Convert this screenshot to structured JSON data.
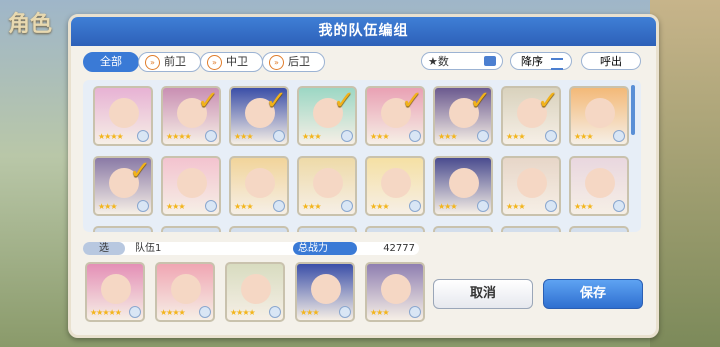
{
  "background": {
    "title": "角色"
  },
  "dialog": {
    "title": "我的队伍编组"
  },
  "filters": [
    {
      "label": "全部",
      "active": true
    },
    {
      "label": "前卫",
      "active": false
    },
    {
      "label": "中卫",
      "active": false
    },
    {
      "label": "后卫",
      "active": false
    }
  ],
  "sort": {
    "label": "★数"
  },
  "order": {
    "label": "降序"
  },
  "call_button": {
    "label": "呼出"
  },
  "roster": [
    {
      "checked": false,
      "stars": "★★★★",
      "color": "#e7b2d4"
    },
    {
      "checked": true,
      "stars": "★★★★",
      "color": "#c98fb3"
    },
    {
      "checked": true,
      "stars": "★★★",
      "color": "#3b4fa8"
    },
    {
      "checked": true,
      "stars": "★★★",
      "color": "#9cd7c4"
    },
    {
      "checked": true,
      "stars": "★★★",
      "color": "#e9a1b4"
    },
    {
      "checked": true,
      "stars": "★★★",
      "color": "#6b5a8f"
    },
    {
      "checked": true,
      "stars": "★★★",
      "color": "#d9d2bd"
    },
    {
      "checked": false,
      "stars": "★★★",
      "color": "#f3b978"
    },
    {
      "checked": true,
      "stars": "★★★",
      "color": "#8a7aa6"
    },
    {
      "checked": false,
      "stars": "★★★",
      "color": "#f3c3cf"
    },
    {
      "checked": false,
      "stars": "★★★",
      "color": "#f1d49a"
    },
    {
      "checked": false,
      "stars": "★★★",
      "color": "#eedaa8"
    },
    {
      "checked": false,
      "stars": "★★★",
      "color": "#f5e0a4"
    },
    {
      "checked": false,
      "stars": "★★★",
      "color": "#4a4c8f"
    },
    {
      "checked": false,
      "stars": "★★★",
      "color": "#e7d6c8"
    },
    {
      "checked": false,
      "stars": "★★★",
      "color": "#e9d7df"
    }
  ],
  "team": {
    "tag": "选",
    "name": "队伍1"
  },
  "power": {
    "label": "总战力",
    "value": "42777"
  },
  "team_members": [
    {
      "stars": "★★★★★",
      "color": "#e48fb6"
    },
    {
      "stars": "★★★★",
      "color": "#f0a6b3"
    },
    {
      "stars": "★★★★",
      "color": "#d8dcc0"
    },
    {
      "stars": "★★★",
      "color": "#3b4fa8"
    },
    {
      "stars": "★★★",
      "color": "#8f7fb1"
    }
  ],
  "buttons": {
    "cancel": "取消",
    "save": "保存"
  }
}
